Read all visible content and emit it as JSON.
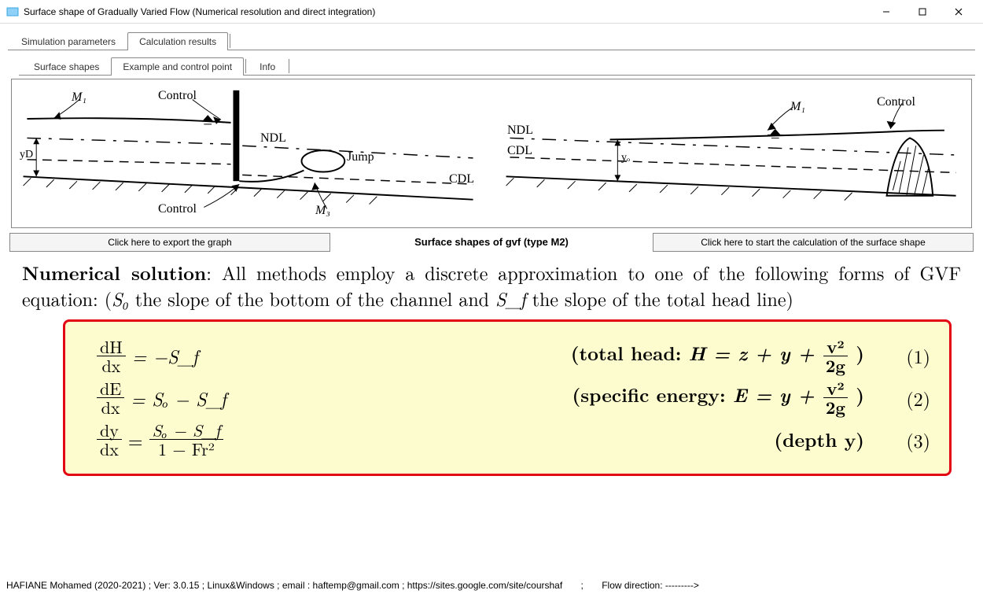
{
  "window": {
    "title": "Surface shape of Gradually Varied Flow (Numerical resolution and direct integration)"
  },
  "tabs_main": {
    "items": [
      {
        "label": "Simulation parameters"
      },
      {
        "label": "Calculation results"
      }
    ],
    "active_index": 1
  },
  "tabs_sub": {
    "items": [
      {
        "label": "Surface shapes"
      },
      {
        "label": "Example and control point"
      },
      {
        "label": "Info"
      }
    ],
    "active_index": 1
  },
  "diagram": {
    "left": {
      "M1": "M₁",
      "control_top": "Control",
      "control_bottom": "Control",
      "NDL": "NDL",
      "CDL": "CDL",
      "jump": "Jump",
      "yd": "yD",
      "M3": "M₃"
    },
    "right": {
      "NDL": "NDL",
      "CDL": "CDL",
      "M1": "M₁",
      "control": "Control",
      "yo": "yₒ"
    }
  },
  "actions": {
    "export_label": "Click here to export the graph",
    "center_label": "Surface shapes of gvf (type M2)",
    "calc_label": "Click here to start the calculation of the surface shape"
  },
  "explanation": {
    "heading": "Numerical solution",
    "body1": ": All methods employ a discrete approximation to one of the following forms of GVF equation: (",
    "s0": "S₀",
    "body2": " the slope of the bottom of the channel and ",
    "sf": "S_f",
    "body3": " the slope of the total head line)"
  },
  "equations": {
    "eq1": {
      "lhs_top": "dH",
      "lhs_bot": "dx",
      "rhs": "= −S_f",
      "desc_prefix": "(total head: ",
      "desc_core": "H = z + y + ",
      "vfrac_top": "v²",
      "vfrac_bot": "2g",
      "desc_suffix": ")",
      "num": "(1)"
    },
    "eq2": {
      "lhs_top": "dE",
      "lhs_bot": "dx",
      "rhs": "= Sₒ − S_f",
      "desc_prefix": "(specific energy: ",
      "desc_core": "E = y + ",
      "vfrac_top": "v²",
      "vfrac_bot": "2g",
      "desc_suffix": ")",
      "num": "(2)"
    },
    "eq3": {
      "lhs_top": "dy",
      "lhs_bot": "dx",
      "rhs_eq": "= ",
      "rhs_top": "Sₒ − S_f",
      "rhs_bot": "1 − Fr²",
      "desc": "(depth y)",
      "num": "(3)"
    }
  },
  "status": {
    "left": "HAFIANE Mohamed (2020-2021) ; Ver: 3.0.15 ; Linux&Windows ; email : haftemp@gmail.com ; https://sites.google.com/site/courshaf",
    "sep": ";",
    "flow_label": "Flow direction:",
    "flow_arrow": "--------->"
  }
}
